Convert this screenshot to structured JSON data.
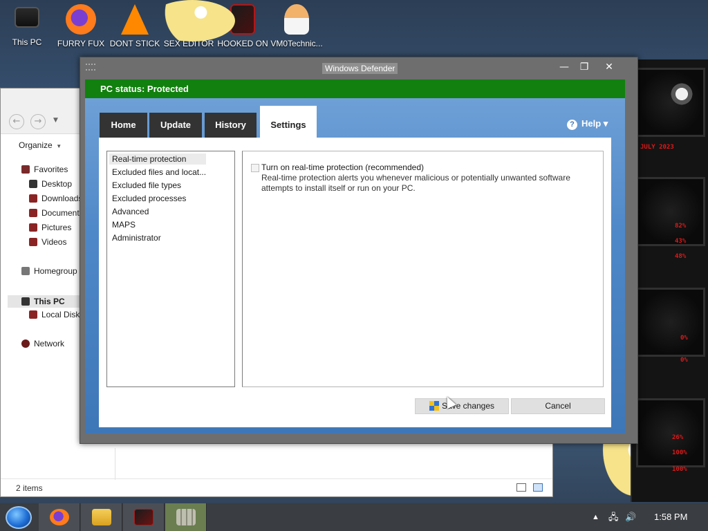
{
  "desktop": {
    "icons": [
      {
        "label": "This PC",
        "icon": "monitor-icon"
      },
      {
        "label": "FURRY FUX",
        "icon": "firefox-icon"
      },
      {
        "label": "DONT STICK",
        "icon": "vlc-cone-icon"
      },
      {
        "label": "SEX EDITOR",
        "icon": "editor-app-icon"
      },
      {
        "label": "HOOKED ON",
        "icon": "hooked-app-icon"
      },
      {
        "label": "VM0Technic...",
        "icon": "doctor-avatar-icon"
      }
    ]
  },
  "gadget": {
    "readouts": [
      "JULY 2023",
      "82%",
      "43%",
      "48%",
      "0%",
      "0%",
      "26%",
      "100%",
      "100%"
    ]
  },
  "explorer": {
    "organize_label": "Organize",
    "tree": {
      "favorites": "Favorites",
      "desktop": "Desktop",
      "downloads": "Downloads",
      "documents": "Documents",
      "pictures": "Pictures",
      "videos": "Videos",
      "homegroup": "Homegroup",
      "this_pc": "This PC",
      "local_disk": "Local Disk (",
      "network": "Network"
    },
    "status_text": "2 items"
  },
  "defender": {
    "window_title": "Windows Defender",
    "status_text": "PC status: Protected",
    "status_color": "#11800e",
    "tabs": [
      {
        "label": "Home",
        "active": false
      },
      {
        "label": "Update",
        "active": false
      },
      {
        "label": "History",
        "active": false
      },
      {
        "label": "Settings",
        "active": true
      }
    ],
    "help_label": "Help ▾",
    "settings_list": [
      "Real-time protection",
      "Excluded files and locat...",
      "Excluded file types",
      "Excluded processes",
      "Advanced",
      "MAPS",
      "Administrator"
    ],
    "realtime": {
      "checkbox_label": "Turn on real-time protection (recommended)",
      "checked": false,
      "description": "Real-time protection alerts you whenever malicious or potentially unwanted software attempts to install itself or run on your PC."
    },
    "save_button": "Save changes",
    "cancel_button": "Cancel"
  },
  "taskbar": {
    "apps": [
      "firefox-icon",
      "file-explorer-icon",
      "gadget-app-icon",
      "windows-defender-icon"
    ],
    "clock": "1:58 PM"
  }
}
